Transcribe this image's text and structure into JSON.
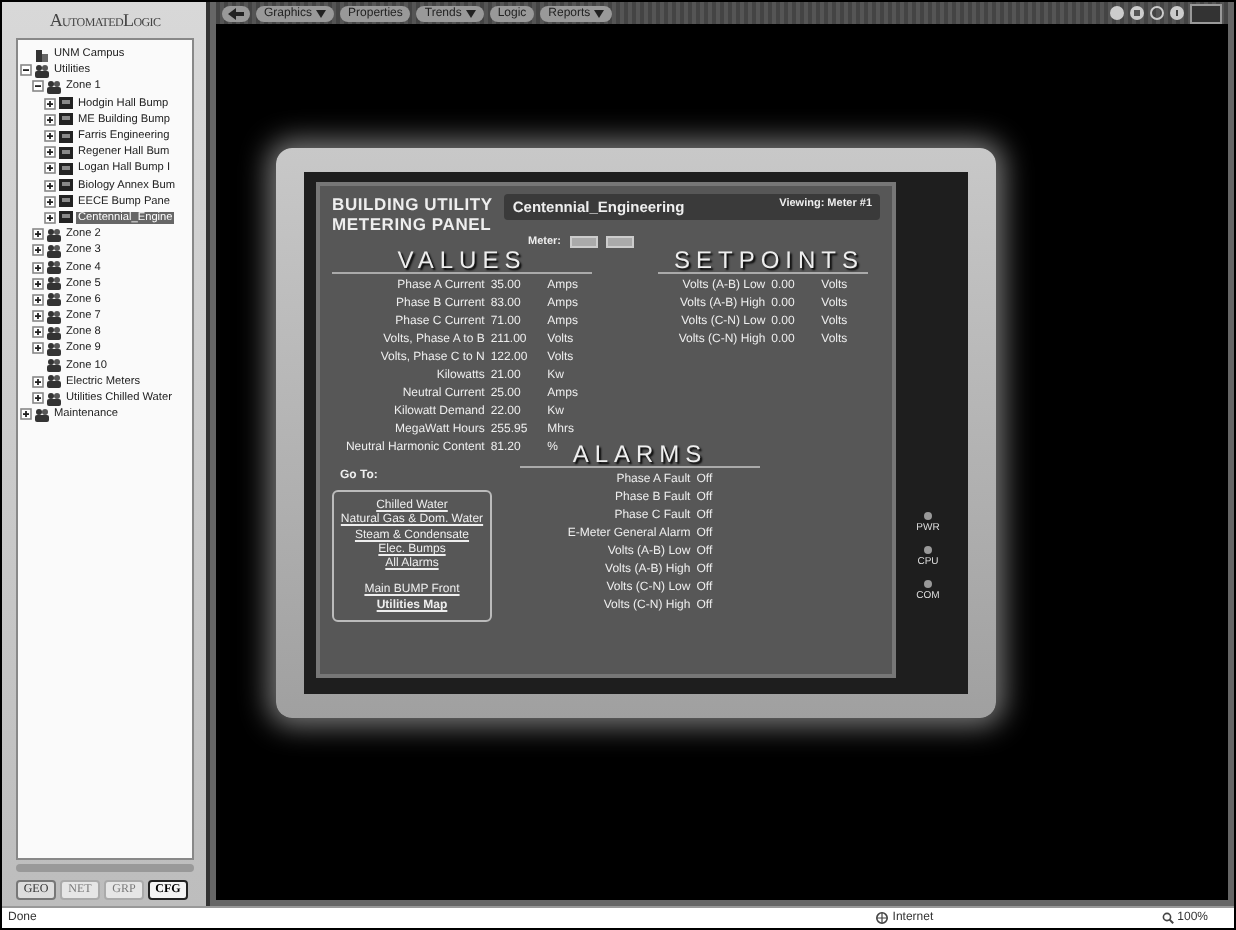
{
  "sidebar": {
    "logo": "AutomatedLogic",
    "tree": [
      {
        "label": "UNM Campus",
        "kind": "site",
        "selected": false
      },
      {
        "label": "Utilities",
        "kind": "group",
        "expanded": true,
        "selected": false,
        "children": [
          {
            "label": "Zone 1",
            "kind": "group",
            "expanded": true,
            "selected": false,
            "children": [
              {
                "label": "Hodgin Hall Bump",
                "kind": "device",
                "expanded": false,
                "selected": false
              },
              {
                "label": "ME Building Bump",
                "kind": "device",
                "expanded": false,
                "selected": false
              },
              {
                "label": "Farris Engineering",
                "kind": "device",
                "expanded": false,
                "selected": false
              },
              {
                "label": "Regener Hall Bum",
                "kind": "device",
                "expanded": false,
                "selected": false
              },
              {
                "label": "Logan Hall Bump I",
                "kind": "device",
                "expanded": false,
                "selected": false
              },
              {
                "label": "Biology Annex Bum",
                "kind": "device",
                "expanded": false,
                "selected": false
              },
              {
                "label": "EECE Bump Pane",
                "kind": "device",
                "expanded": false,
                "selected": false
              },
              {
                "label": "Centennial_Engine",
                "kind": "device",
                "expanded": false,
                "selected": true
              }
            ]
          },
          {
            "label": "Zone 2",
            "kind": "group",
            "expanded": false,
            "selected": false
          },
          {
            "label": "Zone 3",
            "kind": "group",
            "expanded": false,
            "selected": false
          },
          {
            "label": "Zone 4",
            "kind": "group",
            "expanded": false,
            "selected": false
          },
          {
            "label": "Zone 5",
            "kind": "group",
            "expanded": false,
            "selected": false
          },
          {
            "label": "Zone 6",
            "kind": "group",
            "expanded": false,
            "selected": false
          },
          {
            "label": "Zone 7",
            "kind": "group",
            "expanded": false,
            "selected": false
          },
          {
            "label": "Zone 8",
            "kind": "group",
            "expanded": false,
            "selected": false
          },
          {
            "label": "Zone 9",
            "kind": "group",
            "expanded": false,
            "selected": false
          },
          {
            "label": "Zone 10",
            "kind": "group",
            "selected": false
          },
          {
            "label": "Electric Meters",
            "kind": "group",
            "expanded": false,
            "selected": false
          },
          {
            "label": "Utilities Chilled Water",
            "kind": "group",
            "expanded": false,
            "selected": false
          }
        ]
      },
      {
        "label": "Maintenance",
        "kind": "group",
        "expanded": false,
        "selected": false
      }
    ],
    "view_buttons": [
      {
        "label": "GEO",
        "disabled": false,
        "selected": false
      },
      {
        "label": "NET",
        "disabled": true,
        "selected": false
      },
      {
        "label": "GRP",
        "disabled": true,
        "selected": false
      },
      {
        "label": "CFG",
        "disabled": false,
        "selected": true
      }
    ]
  },
  "toolbar": {
    "buttons": [
      {
        "label": "Graphics",
        "dropdown": true
      },
      {
        "label": "Properties",
        "dropdown": false
      },
      {
        "label": "Trends",
        "dropdown": true
      },
      {
        "label": "Logic",
        "dropdown": false
      },
      {
        "label": "Reports",
        "dropdown": true
      }
    ]
  },
  "panel": {
    "title_lines": [
      "BUILDING UTILITY",
      "METERING PANEL"
    ],
    "equipment": "Centennial_Engineering",
    "viewing": "Viewing: Meter #1",
    "meter_label": "Meter:",
    "values_heading": "VALUES",
    "values": [
      {
        "label": "Phase A Current",
        "value": "35.00",
        "unit": "Amps"
      },
      {
        "label": "Phase B Current",
        "value": "83.00",
        "unit": "Amps"
      },
      {
        "label": "Phase C Current",
        "value": "71.00",
        "unit": "Amps"
      },
      {
        "label": "Volts, Phase A to B",
        "value": "211.00",
        "unit": "Volts"
      },
      {
        "label": "Volts, Phase C to N",
        "value": "122.00",
        "unit": "Volts"
      },
      {
        "label": "Kilowatts",
        "value": "21.00",
        "unit": "Kw"
      },
      {
        "label": "Neutral Current",
        "value": "25.00",
        "unit": "Amps"
      },
      {
        "label": "Kilowatt Demand",
        "value": "22.00",
        "unit": "Kw"
      },
      {
        "label": "MegaWatt Hours",
        "value": "255.95",
        "unit": "Mhrs"
      },
      {
        "label": "Neutral Harmonic Content",
        "value": "81.20",
        "unit": "%"
      }
    ],
    "setpoints_heading": "SETPOINTS",
    "setpoints": [
      {
        "label": "Volts (A-B) Low",
        "value": "0.00",
        "unit": "Volts"
      },
      {
        "label": "Volts (A-B) High",
        "value": "0.00",
        "unit": "Volts"
      },
      {
        "label": "Volts (C-N) Low",
        "value": "0.00",
        "unit": "Volts"
      },
      {
        "label": "Volts (C-N) High",
        "value": "0.00",
        "unit": "Volts"
      }
    ],
    "goto_label": "Go To:",
    "goto_links": [
      {
        "label": "Chilled Water",
        "kind": "link"
      },
      {
        "label": "Natural Gas & Dom. Water",
        "kind": "link"
      },
      {
        "label": "Steam & Condensate",
        "kind": "link"
      },
      {
        "label": "Elec. Bumps",
        "kind": "link"
      },
      {
        "label": "All Alarms",
        "kind": "link"
      },
      {
        "label": "Main BUMP Front",
        "kind": "spaced"
      },
      {
        "label": "Utilities Map",
        "kind": "bold"
      }
    ],
    "alarms_heading": "ALARMS",
    "alarms": [
      {
        "label": "Phase A Fault",
        "value": "Off"
      },
      {
        "label": "Phase B Fault",
        "value": "Off"
      },
      {
        "label": "Phase C Fault",
        "value": "Off"
      },
      {
        "label": "E-Meter General Alarm",
        "value": "Off"
      },
      {
        "label": "Volts (A-B) Low",
        "value": "Off"
      },
      {
        "label": "Volts (A-B) High",
        "value": "Off"
      },
      {
        "label": "Volts (C-N) Low",
        "value": "Off"
      },
      {
        "label": "Volts (C-N) High",
        "value": "Off"
      }
    ],
    "leds": [
      {
        "label": "PWR",
        "on": false
      },
      {
        "label": "CPU",
        "on": false
      },
      {
        "label": "COM",
        "on": false
      }
    ]
  },
  "status_bar": {
    "text": "Done",
    "zone": "Internet",
    "zoom": "100%"
  }
}
